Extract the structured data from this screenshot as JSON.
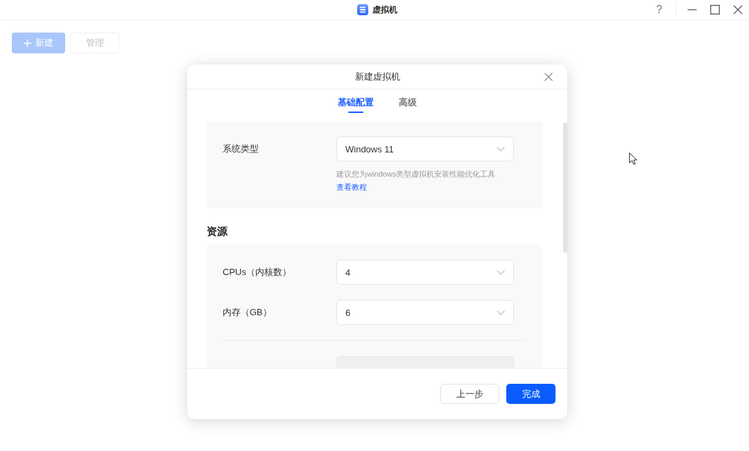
{
  "window": {
    "title": "虚拟机",
    "help_button": "?"
  },
  "toolbar": {
    "buttons": [
      {
        "kind": "primary",
        "label": "新建"
      },
      {
        "kind": "default",
        "label": "管理"
      }
    ]
  },
  "dialog": {
    "title": "新建虚拟机",
    "tabs": [
      {
        "label": "基础配置",
        "selected": true
      },
      {
        "label": "高级",
        "selected": false
      }
    ],
    "sections": [
      {
        "groups": [
          [
            {
              "label": "系统类型",
              "value": "Windows 11",
              "disabled": false,
              "hint": "建议您为windows类型虚拟机安装性能优化工具",
              "link": "查看教程"
            }
          ]
        ]
      },
      {
        "heading": "资源",
        "groups": [
          [
            {
              "label": "CPUs（内核数）",
              "value": "4",
              "disabled": false
            },
            {
              "label": "内存（GB）",
              "value": "6",
              "disabled": false
            }
          ],
          [
            {
              "disabled": true
            }
          ]
        ]
      }
    ],
    "buttons": [
      {
        "kind": "default",
        "label": "上一步"
      },
      {
        "kind": "primary",
        "label": "完成"
      }
    ]
  }
}
